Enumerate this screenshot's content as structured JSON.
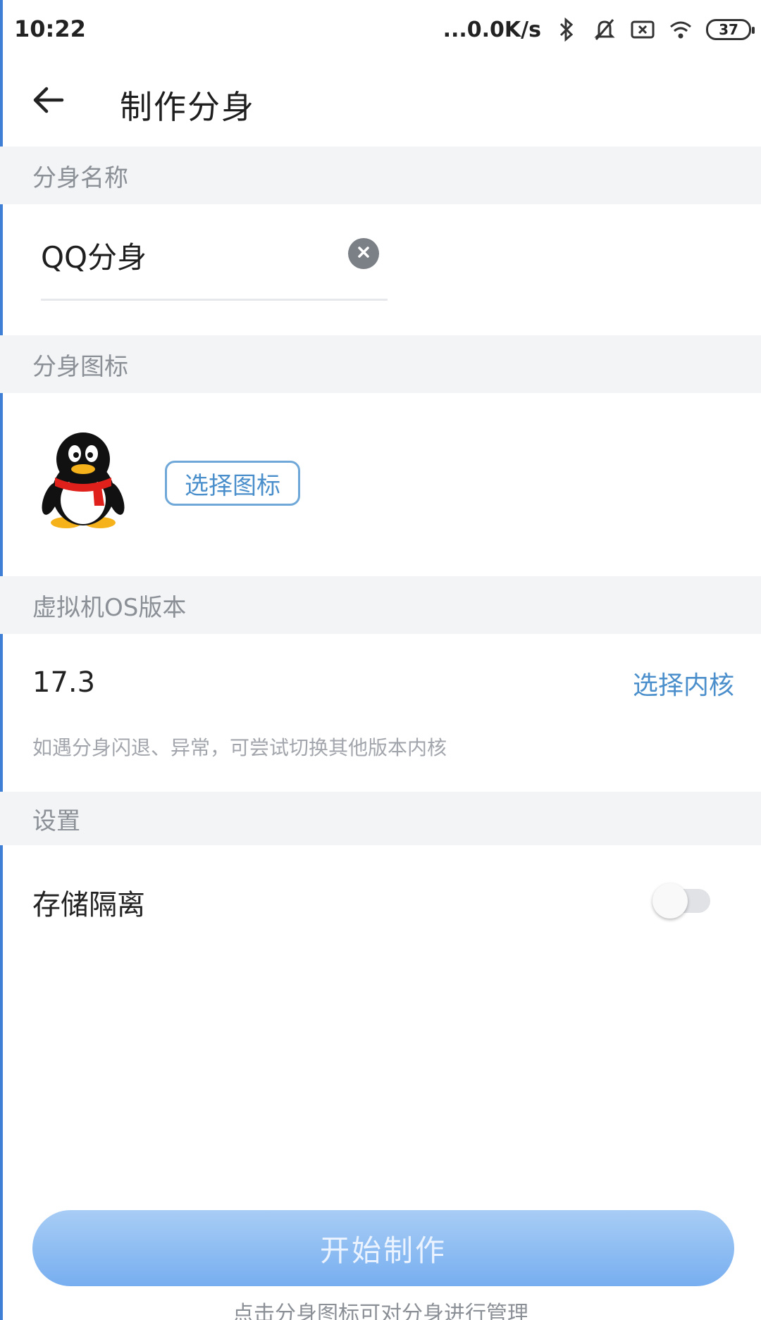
{
  "status_bar": {
    "time": "10:22",
    "net_speed": "...0.0K/s",
    "battery": "37",
    "icons": [
      "bluetooth-icon",
      "bell-muted-icon",
      "sim-x-icon",
      "wifi-icon",
      "battery-icon"
    ]
  },
  "header": {
    "title": "制作分身",
    "back_icon": "arrow-left-icon"
  },
  "sections": {
    "name_header": "分身名称",
    "icon_header": "分身图标",
    "os_header": "虚拟机OS版本",
    "settings_header": "设置"
  },
  "name_field": {
    "value": "QQ分身",
    "clear_icon": "clear-circle-icon"
  },
  "icon_picker": {
    "app_icon": "qq-penguin-icon",
    "choose_label": "选择图标"
  },
  "os": {
    "version": "17.3",
    "choose_kernel_label": "选择内核",
    "hint": "如遇分身闪退、异常，可尝试切换其他版本内核"
  },
  "settings": {
    "storage_isolation_label": "存储隔离",
    "storage_isolation_enabled": false
  },
  "footer": {
    "start_label": "开始制作",
    "hint": "点击分身图标可对分身进行管理"
  },
  "colors": {
    "accent": "#4a8fcb",
    "button_gradient_top": "#a8cdf5",
    "button_gradient_bottom": "#77aef0",
    "section_bg": "#f3f4f6"
  }
}
